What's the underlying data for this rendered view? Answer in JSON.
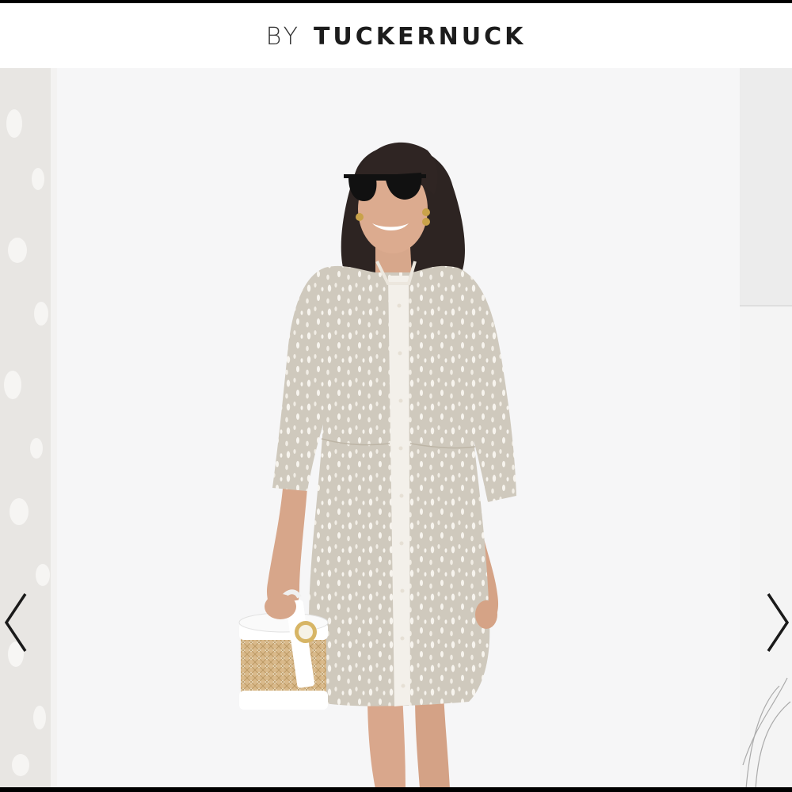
{
  "header": {
    "brand_prefix": "BY",
    "brand_name": "TUCKERNUCK"
  },
  "carousel": {
    "prev_icon": "chevron-left-icon",
    "next_icon": "chevron-right-icon"
  },
  "colors": {
    "background": "#ffffff",
    "photo_backdrop": "#f6f6f7",
    "dress": "#cfc9bd",
    "dress_spots": "#f7f4ee",
    "arrow": "#1a1a1a"
  }
}
